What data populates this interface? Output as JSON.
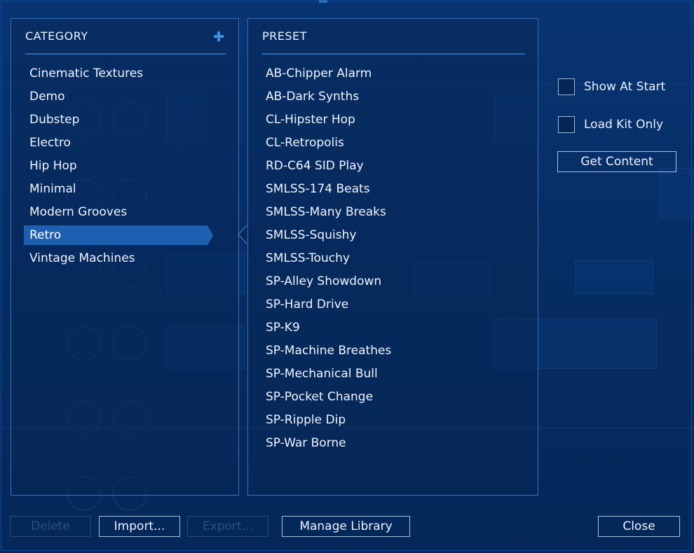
{
  "category_panel": {
    "header": "CATEGORY",
    "items": [
      {
        "label": "Cinematic Textures",
        "selected": false
      },
      {
        "label": "Demo",
        "selected": false
      },
      {
        "label": "Dubstep",
        "selected": false
      },
      {
        "label": "Electro",
        "selected": false
      },
      {
        "label": "Hip Hop",
        "selected": false
      },
      {
        "label": "Minimal",
        "selected": false
      },
      {
        "label": "Modern Grooves",
        "selected": false
      },
      {
        "label": "Retro",
        "selected": true
      },
      {
        "label": "Vintage Machines",
        "selected": false
      }
    ]
  },
  "preset_panel": {
    "header": "PRESET",
    "items": [
      "AB-Chipper Alarm",
      "AB-Dark Synths",
      "CL-Hipster Hop",
      "CL-Retropolis",
      "RD-C64 SID Play",
      "SMLSS-174 Beats",
      "SMLSS-Many Breaks",
      "SMLSS-Squishy",
      "SMLSS-Touchy",
      "SP-Alley Showdown",
      "SP-Hard Drive",
      "SP-K9",
      "SP-Machine Breathes",
      "SP-Mechanical Bull",
      "SP-Pocket Change",
      "SP-Ripple Dip",
      "SP-War Borne"
    ]
  },
  "options": {
    "show_at_start": {
      "label": "Show At Start",
      "checked": false
    },
    "load_kit_only": {
      "label": "Load Kit Only",
      "checked": false
    },
    "get_content_label": "Get Content"
  },
  "footer": {
    "delete_label": "Delete",
    "import_label": "Import...",
    "export_label": "Export...",
    "manage_label": "Manage Library",
    "close_label": "Close"
  },
  "colors": {
    "background": "#062c60",
    "panel_border": "#3a6fb5",
    "selection": "#1f5fb0",
    "accent_plus": "#3c8ee8"
  },
  "icons": {
    "add_category": "plus-icon"
  }
}
